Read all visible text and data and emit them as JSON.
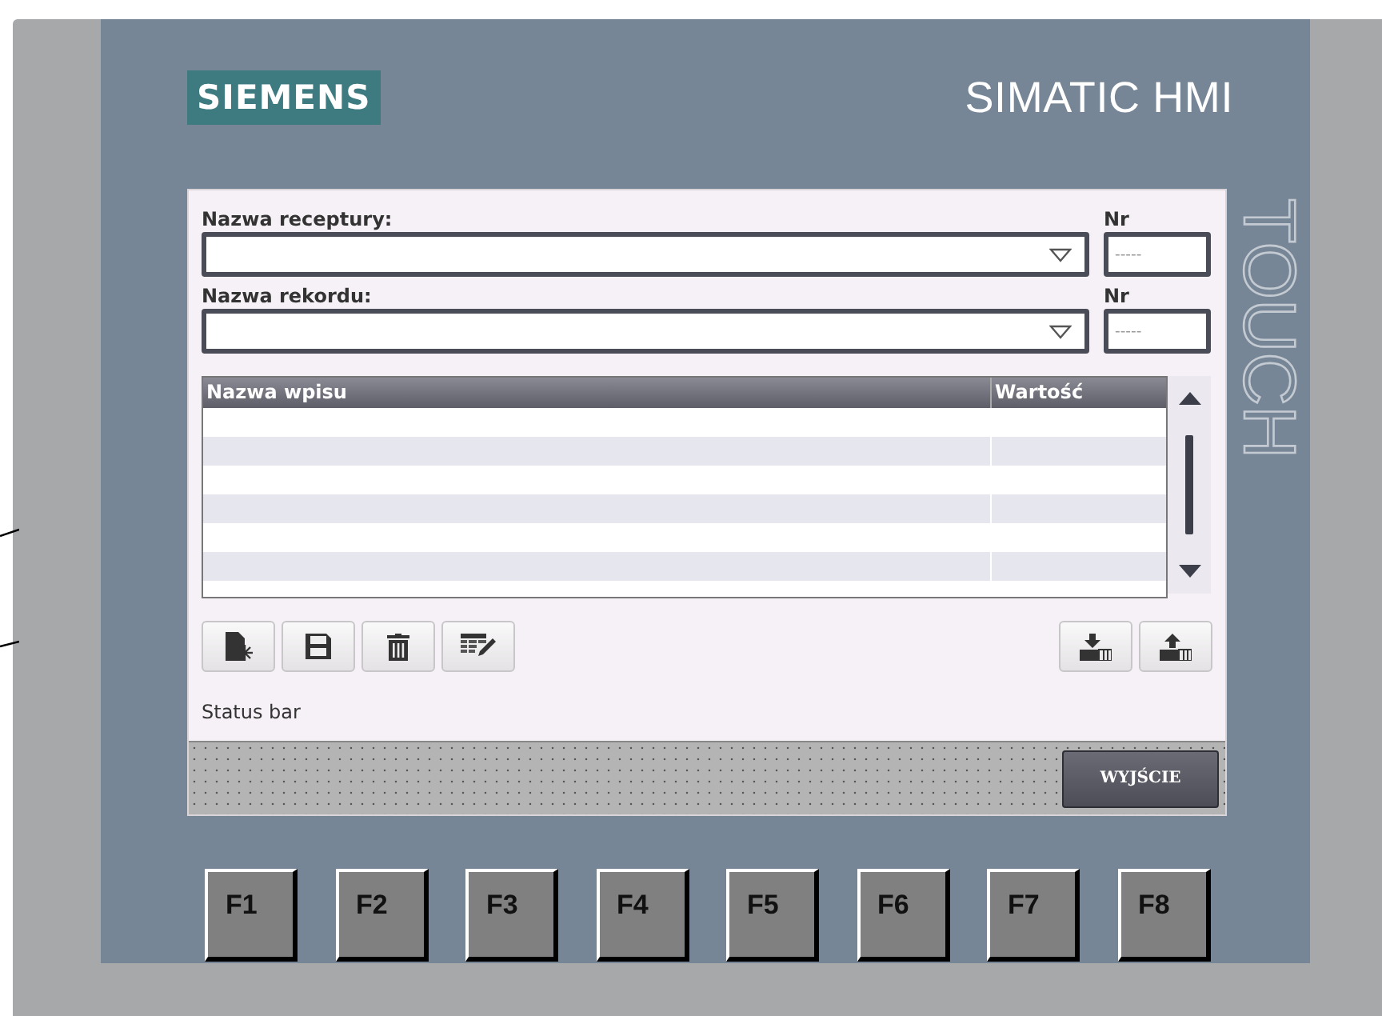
{
  "header": {
    "logo": "SIEMENS",
    "product": "SIMATIC HMI",
    "side_label": "TOUCH"
  },
  "recipe_fields": [
    {
      "label": "Nazwa receptury:",
      "number_label": "Nr",
      "number_placeholder": "-----"
    },
    {
      "label": "Nazwa rekordu:",
      "number_label": "Nr",
      "number_placeholder": "-----"
    }
  ],
  "table": {
    "columns": [
      "Nazwa wpisu",
      "Wartość"
    ]
  },
  "status_bar": "Status bar",
  "exit_button": "WYJŚCIE",
  "function_keys": [
    "F1",
    "F2",
    "F3",
    "F4",
    "F5",
    "F6",
    "F7",
    "F8"
  ]
}
